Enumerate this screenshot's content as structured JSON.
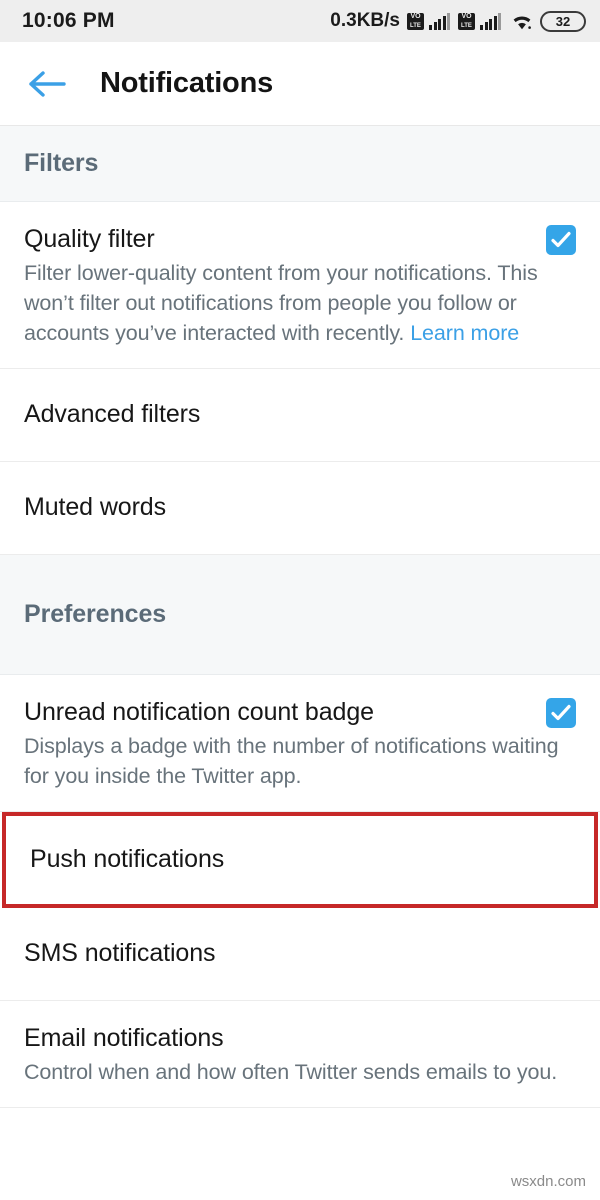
{
  "status_bar": {
    "clock": "10:06 PM",
    "net_speed": "0.3KB/s",
    "sim1_label": "VoLTE",
    "sim2_label": "VoLTE",
    "wifi_label": "wifi-signal",
    "battery_level": "32"
  },
  "app_bar": {
    "back_label": "back-arrow",
    "title": "Notifications",
    "accent_color": "#3ba0e6"
  },
  "sections": [
    {
      "id": "filters",
      "title": "Filters",
      "rows": [
        {
          "id": "quality-filter",
          "title": "Quality filter",
          "description": "Filter lower-quality content from your notifications. This won’t filter out notifications from people you follow or accounts you’ve interacted with recently. ",
          "link_text": "Learn more",
          "checkbox": true,
          "checked": true
        },
        {
          "id": "advanced-filters",
          "title": "Advanced filters",
          "description": "",
          "checkbox": false
        },
        {
          "id": "muted-words",
          "title": "Muted words",
          "description": "",
          "checkbox": false
        }
      ]
    },
    {
      "id": "preferences",
      "title": "Preferences",
      "rows": [
        {
          "id": "unread-badge",
          "title": "Unread notification count badge",
          "description": "Displays a badge with the number of notifications waiting for you inside the Twitter app.",
          "checkbox": true,
          "checked": true
        },
        {
          "id": "push-notifications",
          "title": "Push notifications",
          "description": "",
          "checkbox": false,
          "highlighted": true
        },
        {
          "id": "sms-notifications",
          "title": "SMS notifications",
          "description": "",
          "checkbox": false
        },
        {
          "id": "email-notifications",
          "title": "Email notifications",
          "description": "Control when and how often Twitter sends emails to you.",
          "checkbox": false
        }
      ]
    }
  ],
  "highlight_color": "#c62828",
  "watermark": "wsxdn.com"
}
